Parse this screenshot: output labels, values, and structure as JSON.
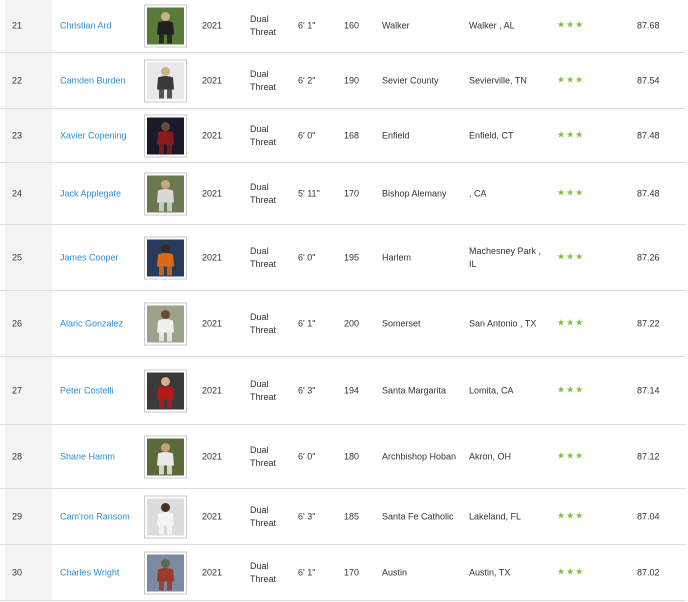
{
  "colors": {
    "link": "#2b8fd6",
    "star": "#7bbf3a",
    "rank_bg": "#f4f4f4",
    "divider": "#dcdcdc"
  },
  "rows": [
    {
      "rank": "21",
      "name": "Christian Ard",
      "year": "2021",
      "position": "Dual Threat",
      "height": "6' 1\"",
      "weight": "160",
      "school": "Walker",
      "hometown": "Walker , AL",
      "stars": "★★★",
      "rating": "87.68",
      "photo": "player-photo"
    },
    {
      "rank": "22",
      "name": "Camden Burden",
      "year": "2021",
      "position": "Dual Threat",
      "height": "6' 2\"",
      "weight": "190",
      "school": "Sevier County",
      "hometown": "Sevierville, TN",
      "stars": "★★★",
      "rating": "87.54",
      "photo": "player-photo"
    },
    {
      "rank": "23",
      "name": "Xavier Copening",
      "year": "2021",
      "position": "Dual Threat",
      "height": "6' 0\"",
      "weight": "168",
      "school": "Enfield",
      "hometown": "Enfield, CT",
      "stars": "★★★",
      "rating": "87.48",
      "photo": "player-photo"
    },
    {
      "rank": "24",
      "name": "Jack Applegate",
      "year": "2021",
      "position": "Dual Threat",
      "height": "5' 11\"",
      "weight": "170",
      "school": "Bishop Alemany",
      "hometown": ", CA",
      "stars": "★★★",
      "rating": "87.48",
      "photo": "player-photo"
    },
    {
      "rank": "25",
      "name": "James Cooper",
      "year": "2021",
      "position": "Dual Threat",
      "height": "6' 0\"",
      "weight": "195",
      "school": "Harlem",
      "hometown": "Machesney Park , IL",
      "stars": "★★★",
      "rating": "87.26",
      "photo": "player-photo"
    },
    {
      "rank": "26",
      "name": "Alaric Gonzalez",
      "year": "2021",
      "position": "Dual Threat",
      "height": "6' 1\"",
      "weight": "200",
      "school": "Somerset",
      "hometown": "San Antonio , TX",
      "stars": "★★★",
      "rating": "87.22",
      "photo": "player-photo"
    },
    {
      "rank": "27",
      "name": "Peter Costelli",
      "year": "2021",
      "position": "Dual Threat",
      "height": "6' 3\"",
      "weight": "194",
      "school": "Santa Margarita",
      "hometown": "Lomita, CA",
      "stars": "★★★",
      "rating": "87.14",
      "photo": "player-photo"
    },
    {
      "rank": "28",
      "name": "Shane Hamm",
      "year": "2021",
      "position": "Dual Threat",
      "height": "6' 0\"",
      "weight": "180",
      "school": "Archbishop Hoban",
      "hometown": "Akron, OH",
      "stars": "★★★",
      "rating": "87.12",
      "photo": "player-photo"
    },
    {
      "rank": "29",
      "name": "Cam'ron Ransom",
      "year": "2021",
      "position": "Dual Threat",
      "height": "6' 3\"",
      "weight": "185",
      "school": "Santa Fe Catholic",
      "hometown": "Lakeland, FL",
      "stars": "★★★",
      "rating": "87.04",
      "photo": "player-photo"
    },
    {
      "rank": "30",
      "name": "Charles Wright",
      "year": "2021",
      "position": "Dual Threat",
      "height": "6' 1\"",
      "weight": "170",
      "school": "Austin",
      "hometown": "Austin, TX",
      "stars": "★★★",
      "rating": "87.02",
      "photo": "player-photo"
    }
  ]
}
